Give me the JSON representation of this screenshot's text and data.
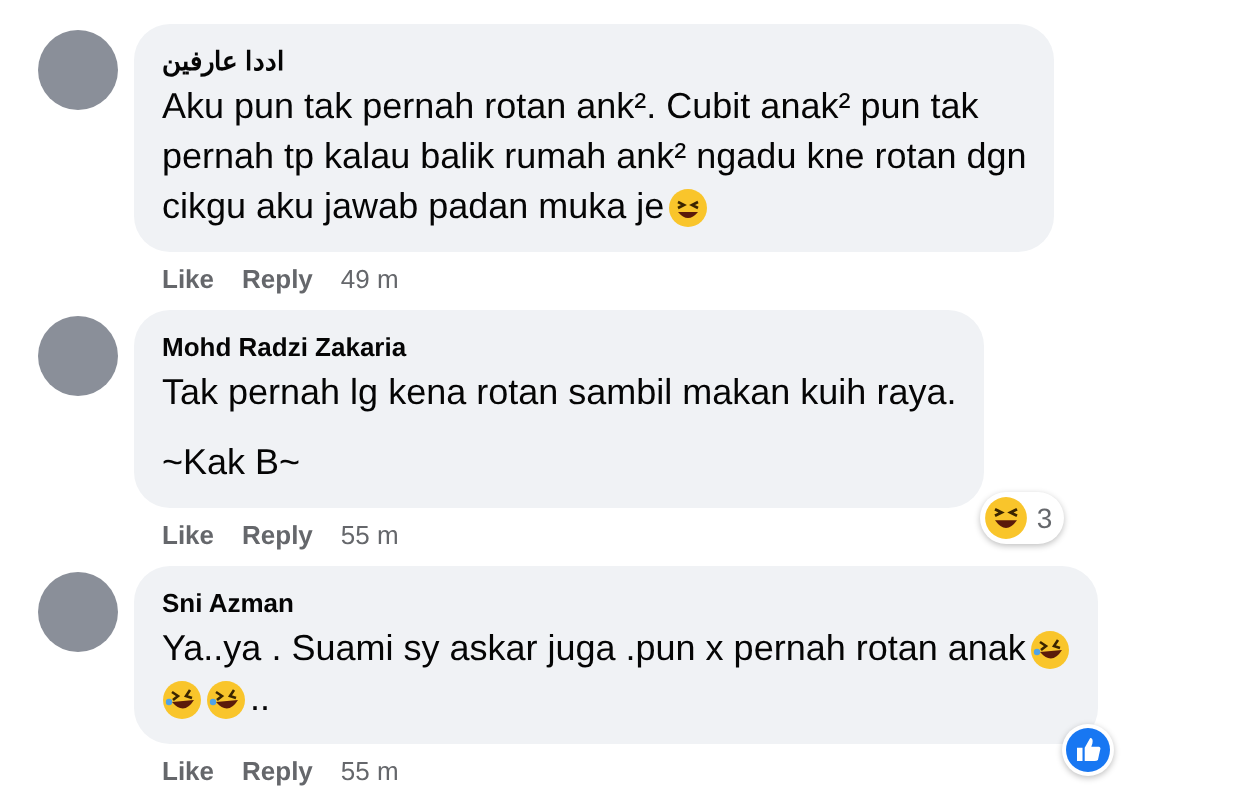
{
  "comments": [
    {
      "author": "اددا عارفين",
      "paragraphs": [
        [
          [
            {
              "kind": "text",
              "text": "Aku pun tak pernah rotan ank². Cubit anak² pun tak"
            }
          ],
          [
            {
              "kind": "text",
              "text": "pernah tp kalau balik rumah ank² ngadu kne rotan dgn"
            }
          ],
          [
            {
              "kind": "text",
              "text": "cikgu aku jawab padan muka je"
            },
            {
              "kind": "squint"
            }
          ]
        ]
      ],
      "actions": [
        "Like",
        "Reply"
      ],
      "time": "49 m"
    },
    {
      "author": "Mohd Radzi Zakaria",
      "paragraphs": [
        [
          [
            {
              "kind": "text",
              "text": "Tak pernah lg kena rotan sambil makan kuih raya."
            }
          ]
        ],
        [
          [
            {
              "kind": "text",
              "text": "~Kak B~"
            }
          ]
        ]
      ],
      "reaction": {
        "kind": "haha",
        "count": "3"
      },
      "actions": [
        "Like",
        "Reply"
      ],
      "time": "55 m"
    },
    {
      "author": "Sni Azman",
      "paragraphs": [
        [
          [
            {
              "kind": "text",
              "text": "Ya..ya . Suami sy askar juga .pun x pernah rotan anak"
            },
            {
              "kind": "rofl"
            }
          ],
          [
            {
              "kind": "rofl"
            },
            {
              "kind": "rofl"
            },
            {
              "kind": "text",
              "text": ".."
            }
          ]
        ]
      ],
      "reaction": {
        "kind": "like"
      },
      "actions": [
        "Like",
        "Reply"
      ],
      "time": "55 m"
    }
  ]
}
